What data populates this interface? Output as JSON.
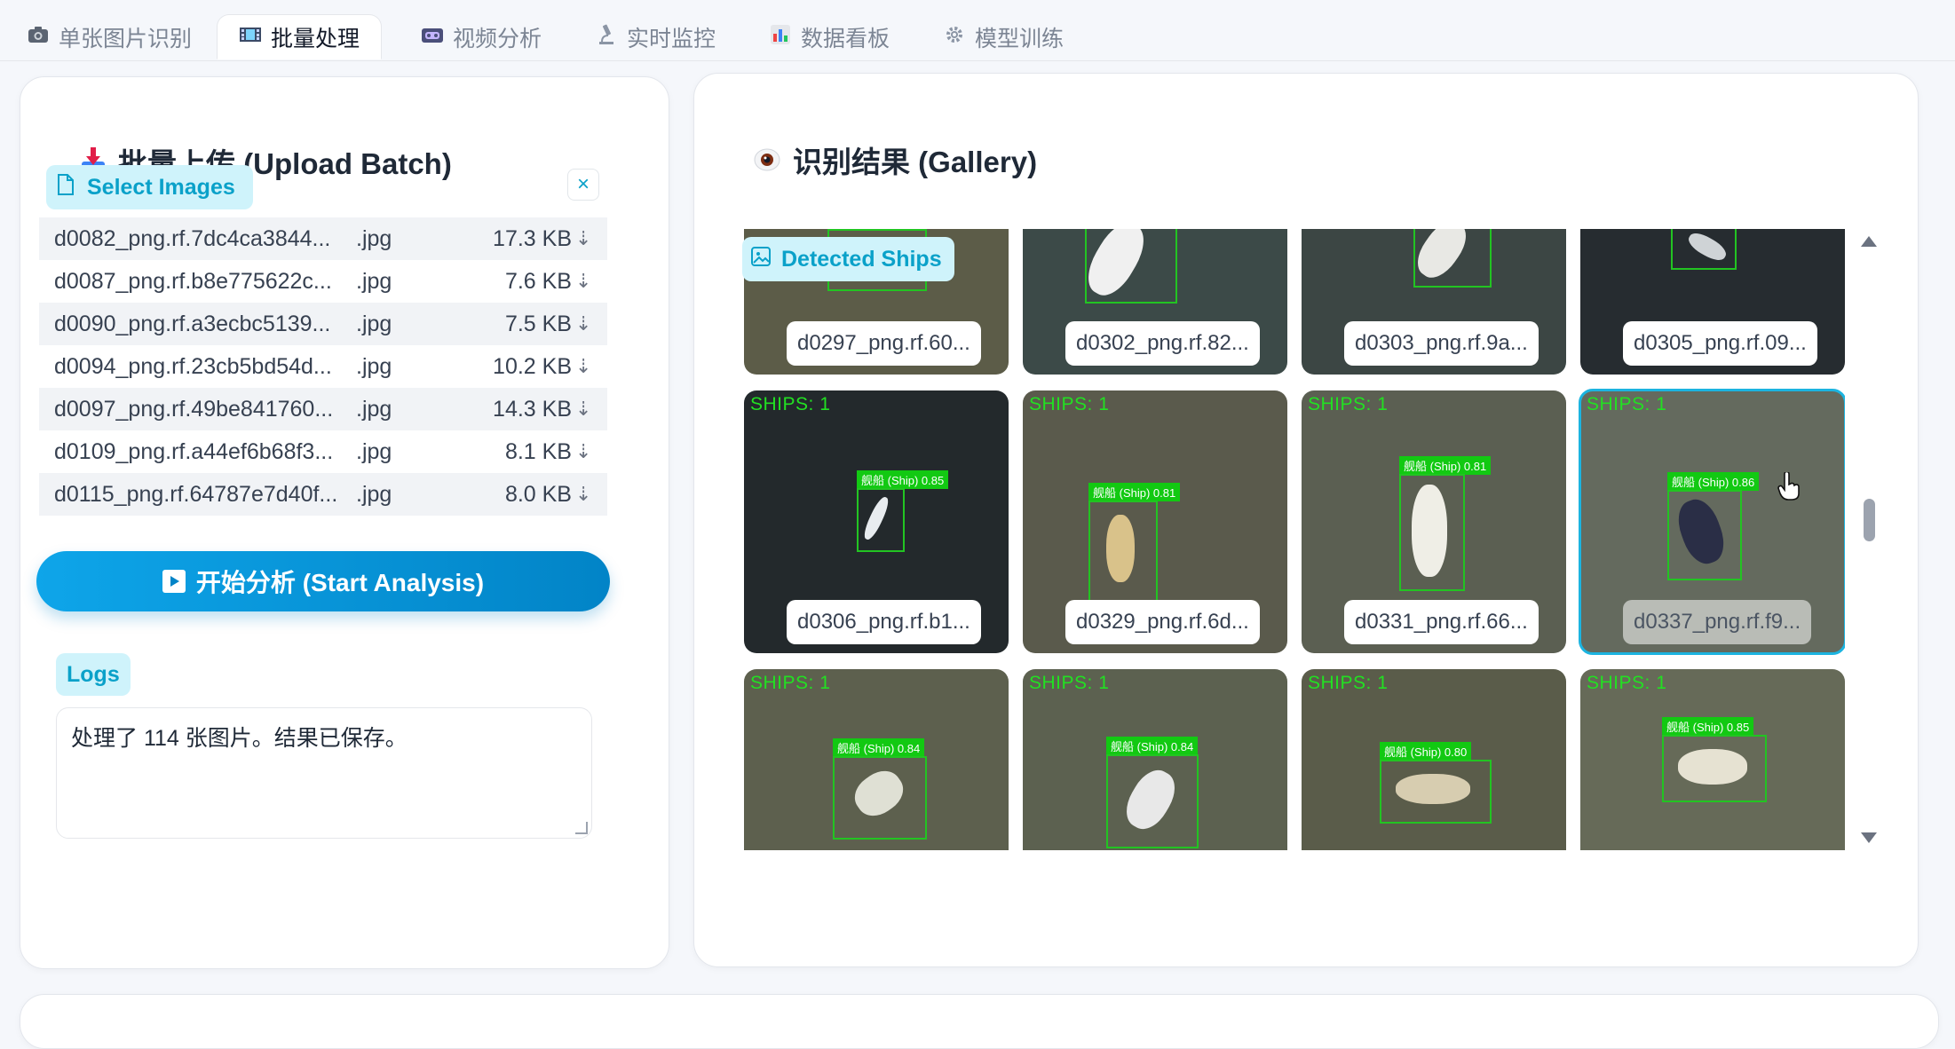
{
  "tabs": [
    {
      "label": "单张图片识别",
      "icon": "camera-icon"
    },
    {
      "label": "批量处理",
      "icon": "film-icon"
    },
    {
      "label": "视频分析",
      "icon": "videotape-icon"
    },
    {
      "label": "实时监控",
      "icon": "microscope-icon"
    },
    {
      "label": "数据看板",
      "icon": "bar-chart-icon"
    },
    {
      "label": "模型训练",
      "icon": "gear-icon"
    }
  ],
  "active_tab": "批量处理",
  "upload": {
    "title": "批量上传 (Upload Batch)",
    "select_label": "Select Images",
    "files": [
      {
        "name": "d0082_png.rf.7dc4ca3844...",
        "ext": ".jpg",
        "size": "17.3 KB"
      },
      {
        "name": "d0087_png.rf.b8e775622c...",
        "ext": ".jpg",
        "size": "7.6 KB"
      },
      {
        "name": "d0090_png.rf.a3ecbc5139...",
        "ext": ".jpg",
        "size": "7.5 KB"
      },
      {
        "name": "d0094_png.rf.23cb5bd54d...",
        "ext": ".jpg",
        "size": "10.2 KB"
      },
      {
        "name": "d0097_png.rf.49be841760...",
        "ext": ".jpg",
        "size": "14.3 KB"
      },
      {
        "name": "d0109_png.rf.a44ef6b68f3...",
        "ext": ".jpg",
        "size": "8.1 KB"
      },
      {
        "name": "d0115_png.rf.64787e7d40f...",
        "ext": ".jpg",
        "size": "8.0 KB"
      }
    ],
    "start_label": "开始分析 (Start Analysis)",
    "logs_label": "Logs",
    "logs_text": "处理了 114 张图片。结果已保存。"
  },
  "gallery": {
    "title": "识别结果 (Gallery)",
    "badge_label": "Detected Ships",
    "rows": [
      [
        {
          "caption": "d0297_png.rf.60...",
          "ships": "",
          "det": ""
        },
        {
          "caption": "d0302_png.rf.82...",
          "ships": "",
          "det": ""
        },
        {
          "caption": "d0303_png.rf.9a...",
          "ships": "",
          "det": ""
        },
        {
          "caption": "d0305_png.rf.09...",
          "ships": "",
          "det": ""
        }
      ],
      [
        {
          "caption": "d0306_png.rf.b1...",
          "ships": "SHIPS: 1",
          "det": "舰船 (Ship) 0.85"
        },
        {
          "caption": "d0329_png.rf.6d...",
          "ships": "SHIPS: 1",
          "det": "舰船 (Ship) 0.81"
        },
        {
          "caption": "d0331_png.rf.66...",
          "ships": "SHIPS: 1",
          "det": "舰船 (Ship) 0.81"
        },
        {
          "caption": "d0337_png.rf.f9...",
          "ships": "SHIPS: 1",
          "det": "舰船 (Ship) 0.86"
        }
      ],
      [
        {
          "caption": "",
          "ships": "SHIPS: 1",
          "det": "舰船 (Ship) 0.84"
        },
        {
          "caption": "",
          "ships": "SHIPS: 1",
          "det": "舰船 (Ship) 0.84"
        },
        {
          "caption": "",
          "ships": "SHIPS: 1",
          "det": "舰船 (Ship) 0.80"
        },
        {
          "caption": "",
          "ships": "SHIPS: 1",
          "det": "舰船 (Ship) 0.85"
        }
      ]
    ]
  },
  "colors": {
    "accent": "#0ea5e9",
    "badge_bg": "#cff3fb",
    "badge_text": "#0aa1c9",
    "detection": "#12c912"
  }
}
